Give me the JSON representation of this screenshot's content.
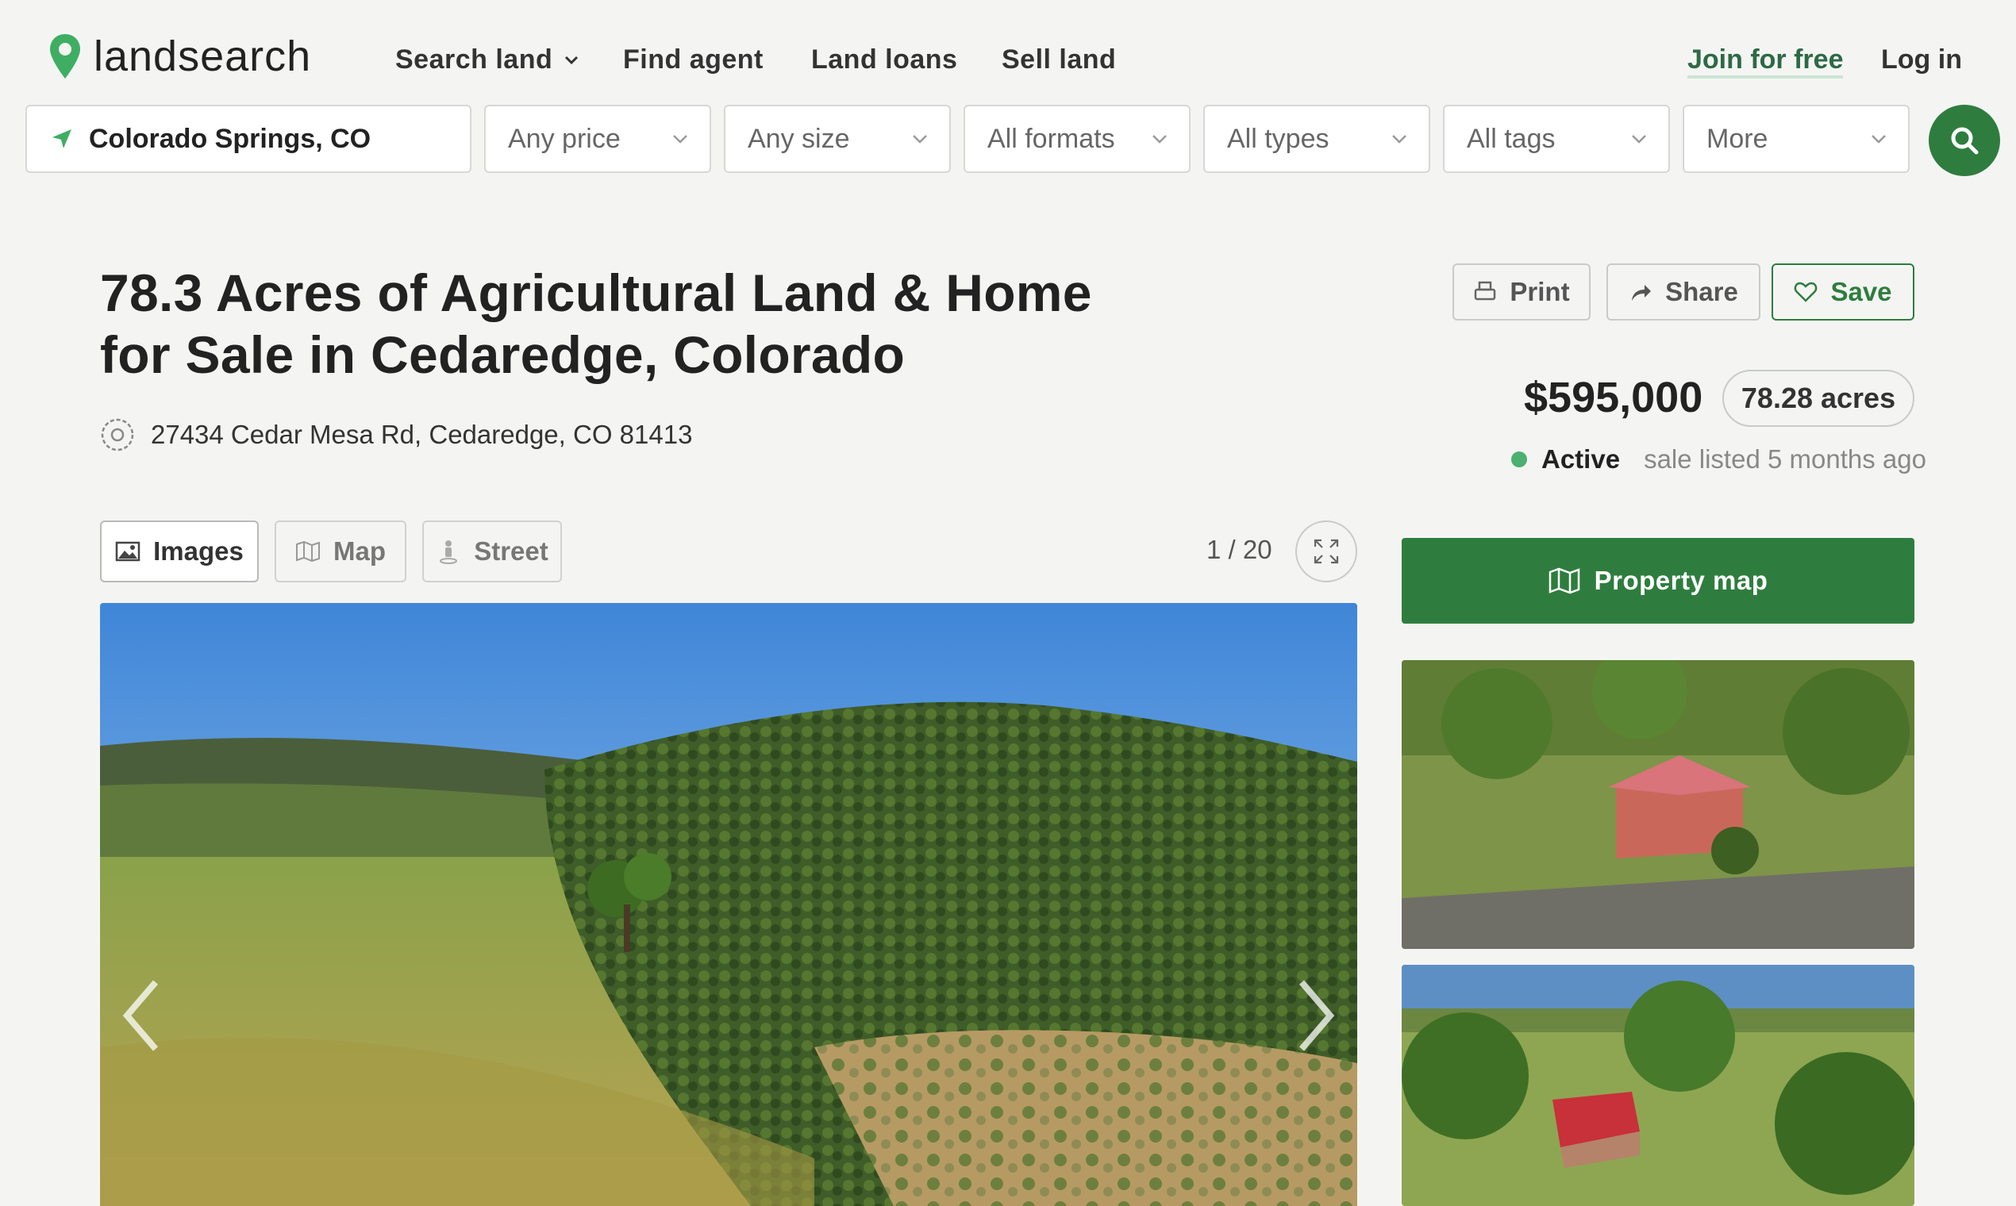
{
  "brand": {
    "name": "landsearch"
  },
  "nav": {
    "search_land": "Search land",
    "find_agent": "Find agent",
    "land_loans": "Land loans",
    "sell_land": "Sell land",
    "join": "Join for free",
    "login": "Log in"
  },
  "filters": {
    "location": "Colorado Springs, CO",
    "price": "Any price",
    "size": "Any size",
    "formats": "All formats",
    "types": "All types",
    "tags": "All tags",
    "more": "More"
  },
  "listing": {
    "title": "78.3 Acres of Agricultural Land & Home for Sale in Cedaredge, Colorado",
    "address": "27434 Cedar Mesa Rd, Cedaredge, CO 81413",
    "price": "$595,000",
    "acres": "78.28 acres",
    "status": "Active",
    "listed": "sale listed 5 months ago"
  },
  "actions": {
    "print": "Print",
    "share": "Share",
    "save": "Save"
  },
  "media": {
    "tabs": {
      "images": "Images",
      "map": "Map",
      "street": "Street"
    },
    "counter": "1 / 20",
    "property_map": "Property map"
  },
  "colors": {
    "accent": "#2e7d3e",
    "active_dot": "#4bb070",
    "background": "#f4f5f3"
  }
}
